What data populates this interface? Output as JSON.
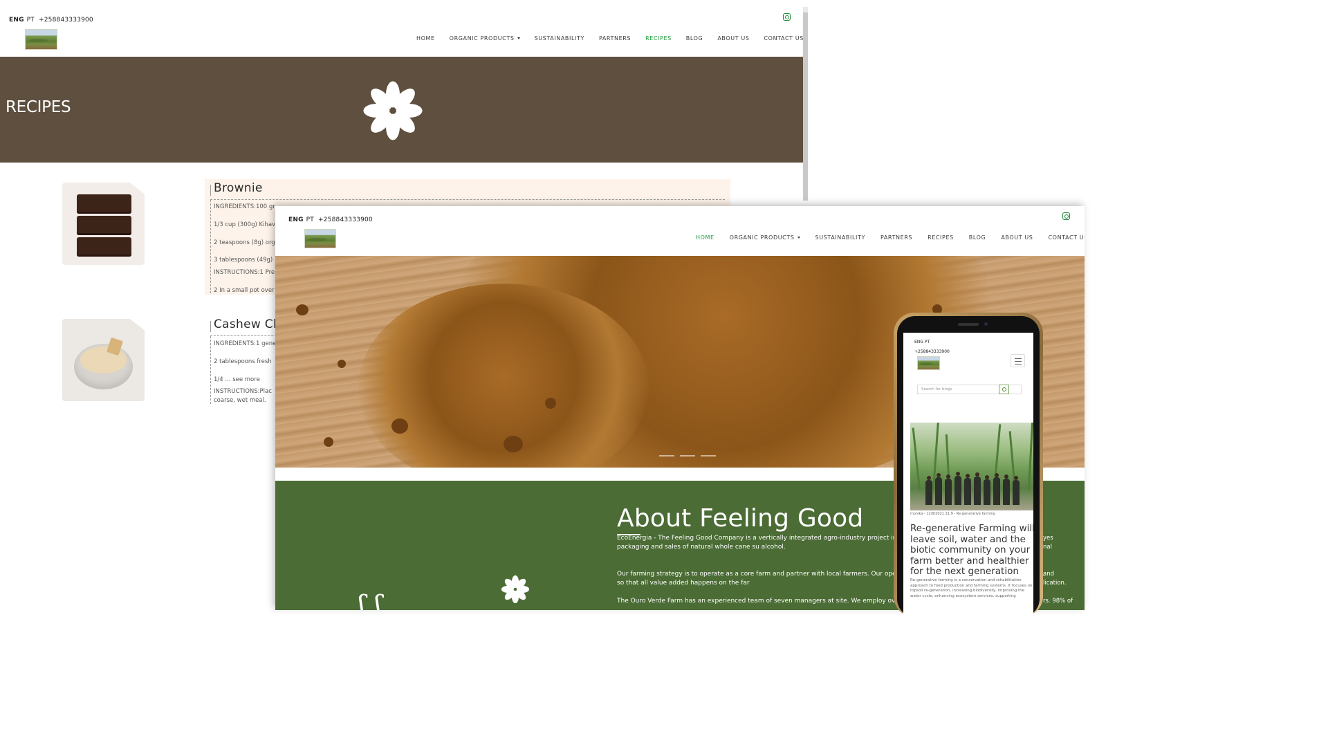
{
  "recipes_page": {
    "lang_eng": "ENG",
    "lang_pt": "PT",
    "phone": "+258843333900",
    "nav": [
      {
        "label": "HOME",
        "active": false
      },
      {
        "label": "ORGANIC PRODUCTS",
        "active": false,
        "dropdown": true
      },
      {
        "label": "SUSTAINABILITY",
        "active": false
      },
      {
        "label": "PARTNERS",
        "active": false
      },
      {
        "label": "RECIPES",
        "active": true
      },
      {
        "label": "BLOG",
        "active": false
      },
      {
        "label": "ABOUT US",
        "active": false
      },
      {
        "label": "CONTACT US",
        "active": false
      }
    ],
    "hero_title": "RECIPES",
    "recipes": [
      {
        "title": "Brownie",
        "lines": [
          "INGREDIENTS:100 gr",
          "1/3 cup (300g) Kihavo",
          "2 teaspoons (8g) org",
          "3 tablespoons (49g)",
          "INSTRUCTIONS:1 Pre",
          "2 In a small pot over"
        ]
      },
      {
        "title": "Cashew Cl",
        "lines": [
          "INGREDIENTS:1 gene",
          "2 tablespoons fresh",
          "1/4 ... see more",
          "INSTRUCTIONS:Plac",
          "coarse, wet meal."
        ]
      }
    ]
  },
  "home_page": {
    "lang_eng": "ENG",
    "lang_pt": "PT",
    "phone": "+258843333900",
    "nav": [
      {
        "label": "HOME",
        "active": true
      },
      {
        "label": "ORGANIC PRODUCTS",
        "active": false,
        "dropdown": true
      },
      {
        "label": "SUSTAINABILITY",
        "active": false
      },
      {
        "label": "PARTNERS",
        "active": false
      },
      {
        "label": "RECIPES",
        "active": false
      },
      {
        "label": "BLOG",
        "active": false
      },
      {
        "label": "ABOUT US",
        "active": false
      },
      {
        "label": "CONTACT US",
        "active": false
      }
    ],
    "about_title": "About Feeling Good",
    "about_p1": "EcoEnergia - The Feeling Good Company is a vertically integrated agro-industry project in organically certified cultivation, processing, packaging and sales of natural whole cane su alcohol.",
    "about_p2": "Our farming strategy is to operate as a core farm and partner with local farmers. Our ope control of the value chain from “farm to table”, so that all value added happens on the far",
    "about_p3": "The Ouro Verde Farm has an experienced team of seven managers at site. We employ over",
    "right_fragments": [
      "yes",
      "nal",
      "and",
      "lication.",
      "rs. 98% of"
    ]
  },
  "mobile_blog": {
    "lang": "ENG  PT",
    "phone": "+258843333900",
    "search_placeholder": "Search for blogs",
    "meta": "monika - 12/9/2021 21:9 - Re-generative farming",
    "title": "Re-generative Farming will leave soil, water and the biotic community on your farm better and healthier for the next generation",
    "excerpt": "Re-generative farming is a conservation and rehabilitation approach to food production and farming systems. It focuses on topsoil re-generation, increasing biodiversity, improving the water cycle, enhancing ecosystem services, supporting"
  },
  "colors": {
    "hero_brown": "#5e4f3e",
    "accent_green": "#1e9a3c",
    "about_green": "#4b6c35"
  }
}
